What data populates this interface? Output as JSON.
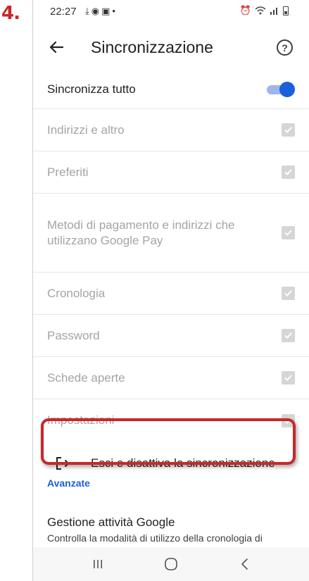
{
  "step_number": "4.",
  "status_bar": {
    "time": "22:27",
    "left_icons": [
      "download-icon",
      "messenger-icon",
      "youtube-icon",
      "dot-icon"
    ],
    "right_icons": [
      "alarm-icon",
      "wifi-icon",
      "signal-icon",
      "battery-icon"
    ]
  },
  "app_bar": {
    "title": "Sincronizzazione",
    "back_icon": "arrow-back-icon",
    "help_icon": "help-icon"
  },
  "sync_all": {
    "label": "Sincronizza tutto",
    "enabled": true
  },
  "sync_items": [
    {
      "label": "Indirizzi e altro",
      "checked": true
    },
    {
      "label": "Preferiti",
      "checked": true
    },
    {
      "label": "Metodi di pagamento e indirizzi che utilizzano Google Pay",
      "checked": true
    },
    {
      "label": "Cronologia",
      "checked": true
    },
    {
      "label": "Password",
      "checked": true
    },
    {
      "label": "Schede aperte",
      "checked": true
    },
    {
      "label": "Impostazioni",
      "checked": true
    }
  ],
  "sign_out": {
    "label": "Esci e disattiva la sincronizzazione",
    "icon": "logout-icon"
  },
  "advanced": {
    "label": "Avanzate"
  },
  "google_activity": {
    "title": "Gestione attività Google",
    "description": "Controlla la modalità di utilizzo della cronologia di"
  },
  "nav_bar": [
    "recent-apps-icon",
    "home-icon",
    "back-icon"
  ],
  "colors": {
    "accent": "#1a5fdb",
    "highlight": "#c8282a",
    "disabled_text": "#a4a4a4"
  }
}
